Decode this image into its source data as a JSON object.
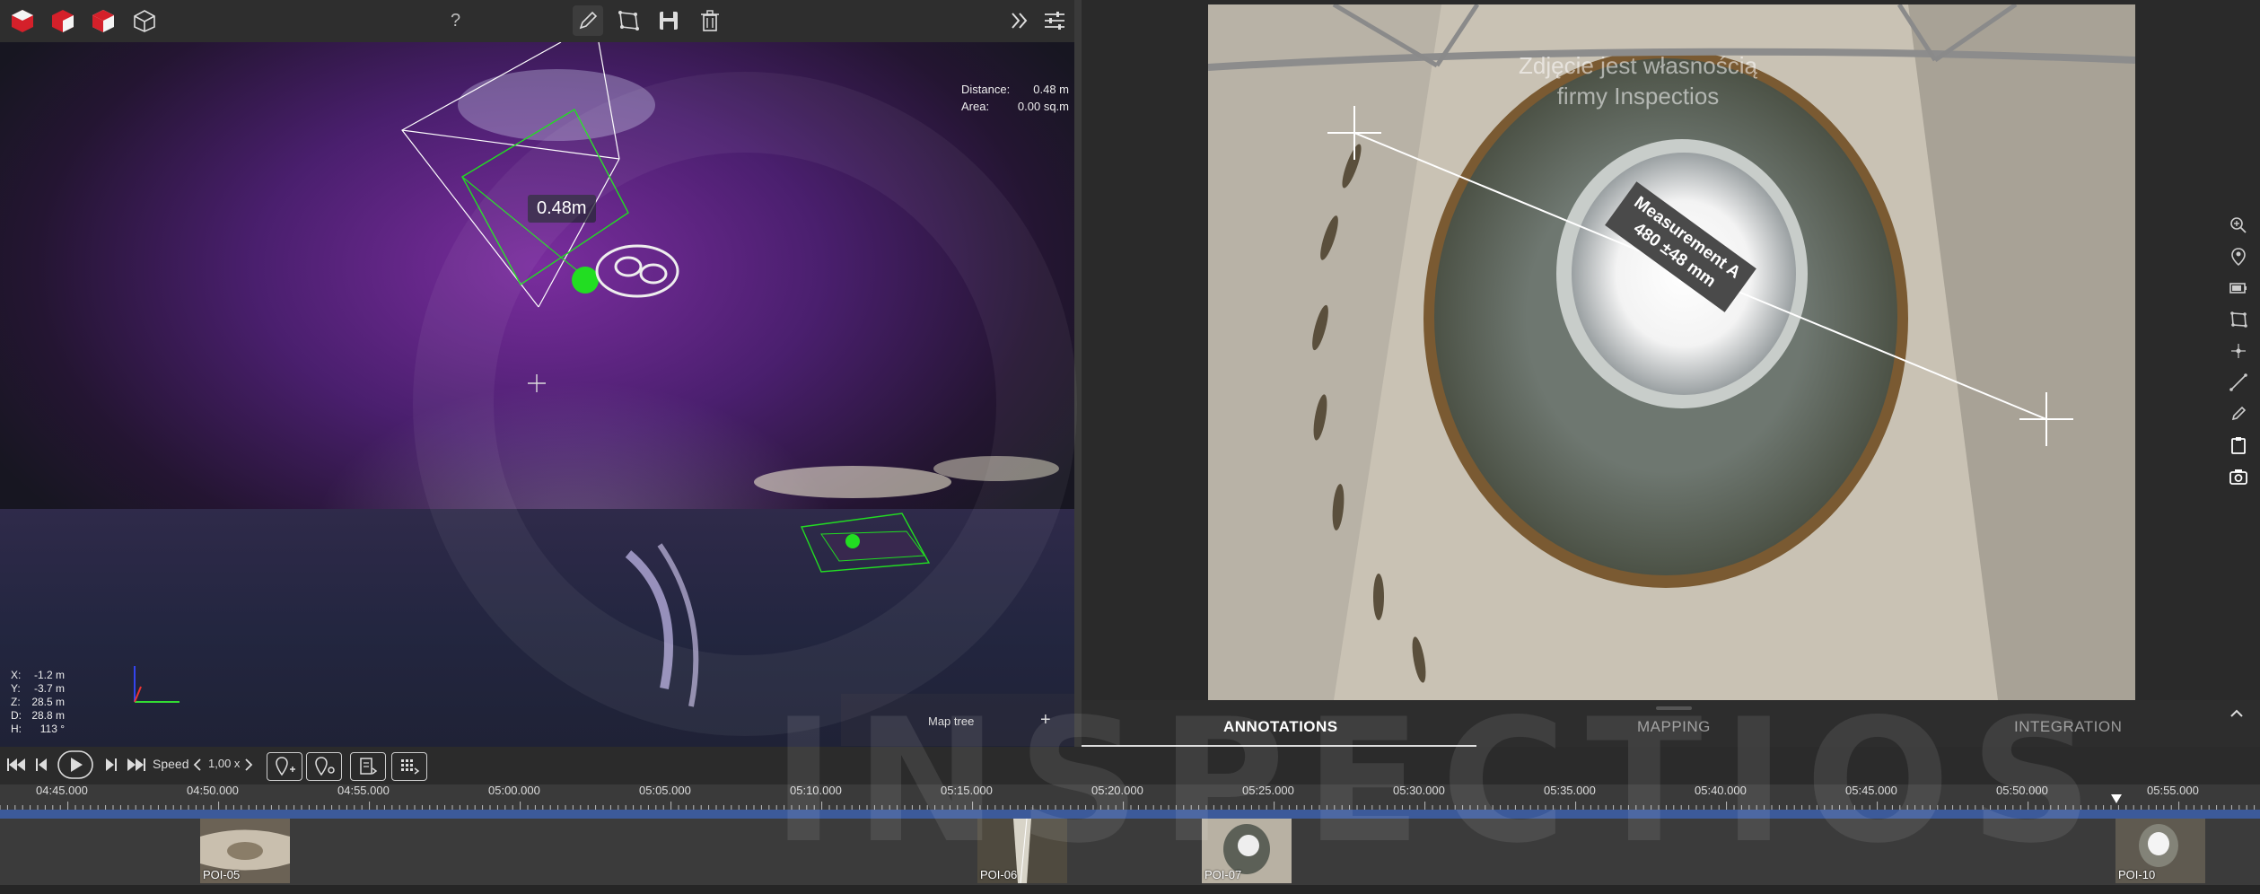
{
  "toolbar": {
    "help_label": "?",
    "icons": [
      "cube-red-icon",
      "cube-red-white-icon",
      "cube-red-outline-icon",
      "cube-wireframe-icon",
      "pencil-icon",
      "polygon-icon",
      "save-icon",
      "trash-icon",
      "forward-icon",
      "sliders-icon"
    ]
  },
  "viewport": {
    "distance_label": "Distance:",
    "distance_value": "0.48 m",
    "area_label": "Area:",
    "area_value": "0.00 sq.m",
    "measurement_label": "0.48m",
    "coords": [
      {
        "k": "X:",
        "v": "-1.2 m"
      },
      {
        "k": "Y:",
        "v": "-3.7 m"
      },
      {
        "k": "Z:",
        "v": "28.5 m"
      },
      {
        "k": "D:",
        "v": "28.8 m"
      },
      {
        "k": "H:",
        "v": "113 °"
      }
    ],
    "map_tree_label": "Map tree",
    "map_tree_plus": "+"
  },
  "photo": {
    "watermark_line1": "Zdjęcie jest własnością",
    "watermark_line2": "firmy Inspectios",
    "measurement_title": "Measurement A",
    "measurement_value": "480 ±48 mm"
  },
  "right_tools": [
    "zoom-in-icon",
    "person-pin-icon",
    "battery-icon",
    "polygon-select-icon",
    "point-icon",
    "line-icon",
    "ruler-icon",
    "clipboard-icon",
    "camera-icon"
  ],
  "tabs": [
    {
      "label": "ANNOTATIONS",
      "active": true
    },
    {
      "label": "MAPPING",
      "active": false
    },
    {
      "label": "INTEGRATION",
      "active": false
    }
  ],
  "playback": {
    "speed_label": "Speed",
    "speed_value": "1,00 x"
  },
  "timeline": {
    "ticks": [
      "04:45.000",
      "04:50.000",
      "04:55.000",
      "05:00.000",
      "05:05.000",
      "05:10.000",
      "05:15.000",
      "05:20.000",
      "05:25.000",
      "05:30.000",
      "05:35.000",
      "05:40.000",
      "05:45.000",
      "05:50.000",
      "05:55.000"
    ],
    "pois": [
      "POI-05",
      "POI-06",
      "POI-07",
      "POI-10"
    ]
  },
  "brand_watermark": "INSPECTIOS",
  "colors": {
    "accent_green": "#22dd22",
    "track_blue": "#3c5a9a",
    "brand_red": "#d4202a"
  }
}
